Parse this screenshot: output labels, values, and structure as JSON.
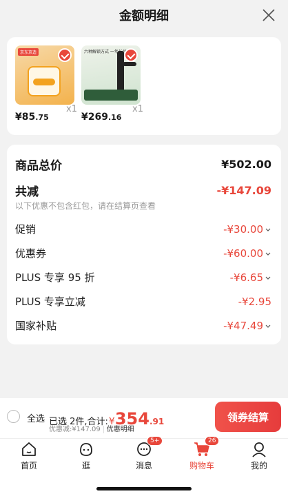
{
  "header": {
    "title": "金额明细"
  },
  "products": [
    {
      "price_int": "¥85",
      "price_dec": ".75",
      "qty": "x1",
      "thumb_label": "京东京造"
    },
    {
      "price_int": "¥269",
      "price_dec": ".16",
      "qty": "x1",
      "thumb_label": "六种解锁方式 一年长续航"
    }
  ],
  "summary": {
    "total_label": "商品总价",
    "total_value": "¥502.00",
    "reduce_label": "共减",
    "reduce_value": "-¥147.09",
    "note": "以下优惠不包含红包，请在结算页查看",
    "items": [
      {
        "label": "促销",
        "value": "-¥30.00"
      },
      {
        "label": "优惠券",
        "value": "-¥60.00"
      },
      {
        "label": "PLUS 专享 95 折",
        "value": "-¥6.65"
      },
      {
        "label": "PLUS 专享立减",
        "value": "-¥2.95"
      },
      {
        "label": "国家补贴",
        "value": "-¥47.49"
      }
    ]
  },
  "bottom": {
    "select_all": "全选",
    "selected_text": "已选 2件,合计:",
    "currency": "¥",
    "amount_int": "354",
    "amount_dec": ".91",
    "discount_text": "优惠减:¥147.09",
    "detail_link": "优惠明细",
    "checkout_label": "领券结算"
  },
  "tabs": [
    {
      "label": "首页",
      "icon": "home-icon"
    },
    {
      "label": "逛",
      "icon": "browse-icon"
    },
    {
      "label": "消息",
      "icon": "message-icon",
      "badge": "5+"
    },
    {
      "label": "购物车",
      "icon": "cart-icon",
      "badge": "26",
      "active": true
    },
    {
      "label": "我的",
      "icon": "profile-icon"
    }
  ],
  "colors": {
    "accent": "#e8473b"
  }
}
